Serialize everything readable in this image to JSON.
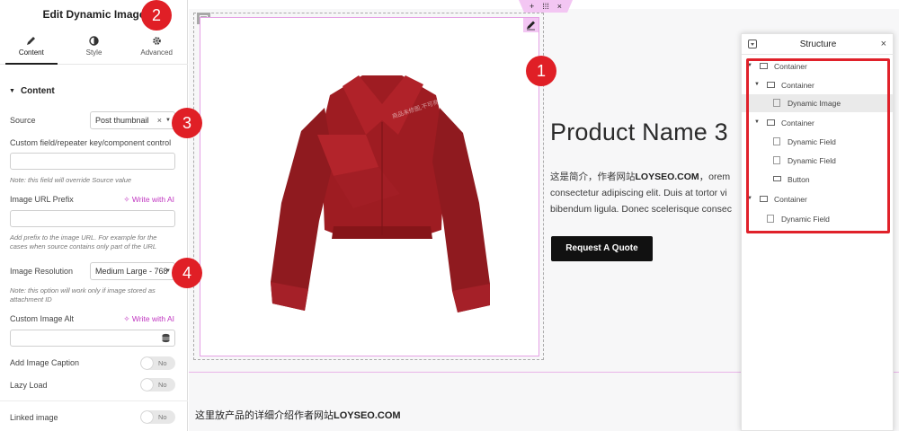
{
  "panel": {
    "title": "Edit Dynamic Image",
    "tabs": [
      {
        "label": "Content",
        "icon": "pencil-icon"
      },
      {
        "label": "Style",
        "icon": "half-circle-icon"
      },
      {
        "label": "Advanced",
        "icon": "gear-icon"
      }
    ],
    "section_title": "Content",
    "source_label": "Source",
    "source_value": "Post thumbnail",
    "custom_field_label": "Custom field/repeater key/component control",
    "custom_field_note": "Note: this field will override Source value",
    "url_prefix_label": "Image URL Prefix",
    "write_with_ai": "Write with AI",
    "url_prefix_note": "Add prefix to the image URL. For example for the cases when source contains only part of the URL",
    "resolution_label": "Image Resolution",
    "resolution_value": "Medium Large - 768",
    "resolution_note": "Note: this option will work only if image stored as attachment ID",
    "custom_alt_label": "Custom Image Alt",
    "add_caption_label": "Add Image Caption",
    "lazy_load_label": "Lazy Load",
    "linked_image_label": "Linked image",
    "toggle_off": "No"
  },
  "canvas": {
    "product_name": "Product Name 3",
    "intro_prefix": "这是简介，作者网站",
    "intro_brand": "LOYSEO.COM",
    "intro_line1_rest": "，orem",
    "intro_line2": "consectetur adipiscing elit. Duis at tortor vi",
    "intro_line3": "bibendum ligula. Donec scelerisque consec",
    "quote_button": "Request A Quote",
    "detail_prefix": "这里放产品的详细介绍作者网站",
    "detail_brand": "LOYSEO.COM",
    "watermark": "商品未修图,不可商用"
  },
  "structure": {
    "title": "Structure",
    "tree": [
      {
        "label": "Container",
        "type": "container",
        "level": 0,
        "expanded": true
      },
      {
        "label": "Container",
        "type": "container",
        "level": 1,
        "expanded": true
      },
      {
        "label": "Dynamic Image",
        "type": "widget",
        "level": 2,
        "selected": true
      },
      {
        "label": "Container",
        "type": "container",
        "level": 1,
        "expanded": true
      },
      {
        "label": "Dynamic Field",
        "type": "widget",
        "level": 2
      },
      {
        "label": "Dynamic Field",
        "type": "widget",
        "level": 2
      },
      {
        "label": "Button",
        "type": "button",
        "level": 2
      },
      {
        "label": "Container",
        "type": "container",
        "level": 0,
        "expanded": true
      },
      {
        "label": "Dynamic Field",
        "type": "widget",
        "level": 1
      }
    ]
  },
  "annotations": [
    "1",
    "2",
    "3",
    "4"
  ],
  "colors": {
    "badge_red": "#e01f26",
    "accent_magenta": "#c036c0",
    "jacket_red": "#9e1c22",
    "button_black": "#111111"
  }
}
